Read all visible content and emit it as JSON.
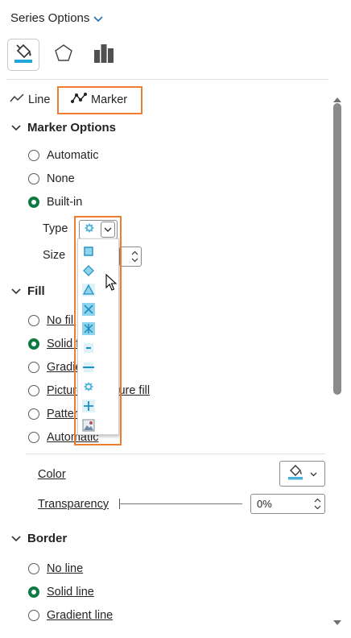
{
  "header": {
    "title": "Series Options"
  },
  "tabs": [
    {
      "name": "fill-line",
      "icon": "paint-bucket-icon",
      "active": true
    },
    {
      "name": "effects",
      "icon": "pentagon-icon",
      "active": false
    },
    {
      "name": "series-options",
      "icon": "bar-chart-icon",
      "active": false
    }
  ],
  "subtabs": {
    "line_label": "Line",
    "marker_label": "Marker"
  },
  "marker_options": {
    "section_label": "Marker Options",
    "automatic": "Automatic",
    "none": "None",
    "builtin": "Built-in",
    "type_label": "Type",
    "size_label": "Size"
  },
  "marker_types": [
    "square",
    "diamond",
    "triangle",
    "x",
    "star",
    "short-dash",
    "long-dash",
    "circle",
    "plus",
    "picture"
  ],
  "fill": {
    "section_label": "Fill",
    "no_fill": "No fill",
    "solid_fill": "Solid fill",
    "gradient_fill": "Gradient fill",
    "picture_fill": "Picture or texture fill",
    "pattern_fill": "Pattern fill",
    "automatic": "Automatic",
    "color_label": "Color",
    "transparency_label": "Transparency",
    "transparency_value": "0%"
  },
  "border": {
    "section_label": "Border",
    "no_line": "No line",
    "solid_line": "Solid line",
    "gradient_line": "Gradient line"
  },
  "colors": {
    "accent": "#ed7d31",
    "marker": "#4ab1d9",
    "selected_radio": "#0e7a43"
  }
}
